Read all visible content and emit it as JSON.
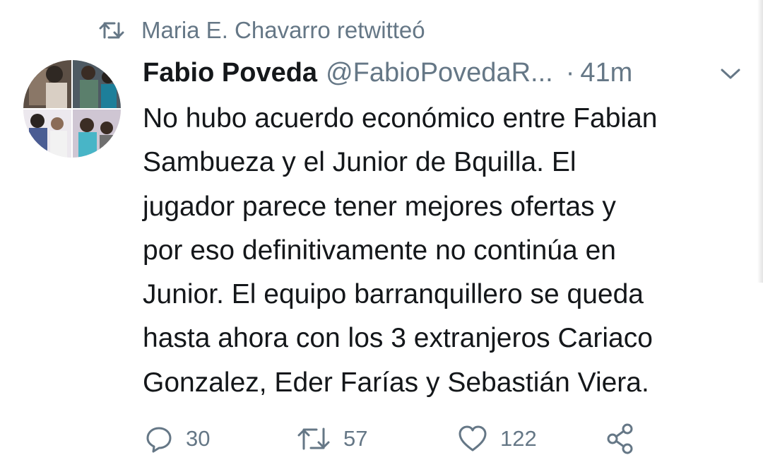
{
  "retweet": {
    "text": "Maria E. Chavarro retwitteó",
    "icon": "retweet-icon"
  },
  "tweet": {
    "author_name": "Fabio Poveda",
    "handle": "@FabioPovedaR...",
    "separator": "·",
    "time": "41m",
    "text_lines": [
      "No hubo acuerdo económico entre Fabian",
      "Sambueza y el Junior de Bquilla. El",
      "jugador parece tener mejores ofertas y",
      "por eso definitivamente no continúa en",
      "Junior. El equipo barranquillero se queda",
      "hasta ahora con los 3 extranjeros Cariaco",
      "Gonzalez, Eder Farías y Sebastián Viera."
    ]
  },
  "actions": {
    "reply": {
      "icon": "reply-icon",
      "count": "30"
    },
    "retweet": {
      "icon": "retweet-icon",
      "count": "57"
    },
    "like": {
      "icon": "heart-icon",
      "count": "122"
    },
    "share": {
      "icon": "share-icon"
    }
  },
  "colors": {
    "primary_text": "#14171a",
    "secondary_text": "#657786",
    "background": "#ffffff"
  }
}
